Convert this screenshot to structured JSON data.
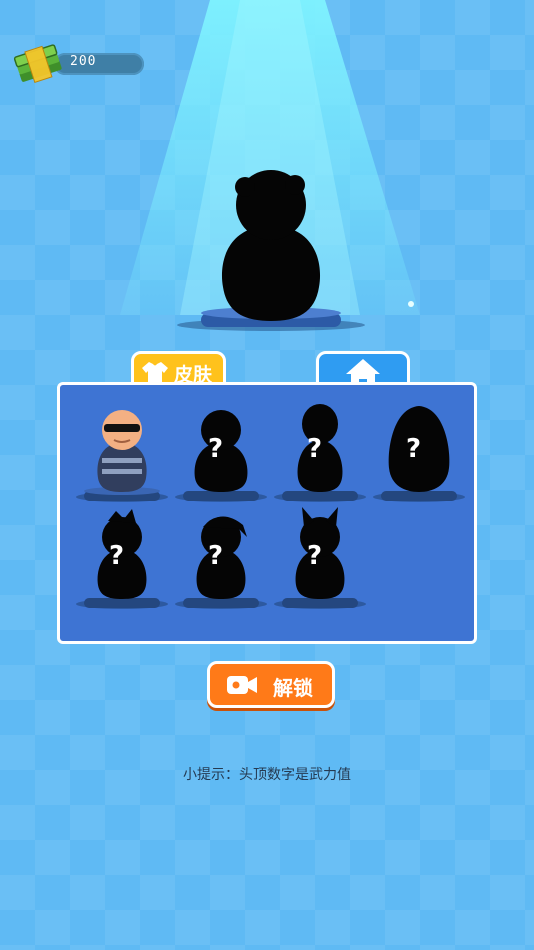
{
  "currency": {
    "amount": "200",
    "icon": "cash-stack-icon"
  },
  "tabs": {
    "skin_label": "皮肤",
    "skin_icon": "shirt-icon",
    "home_icon": "house-icon"
  },
  "featured": {
    "state": "locked-silhouette"
  },
  "characters": [
    {
      "state": "unlocked",
      "label": ""
    },
    {
      "state": "locked",
      "label": "?"
    },
    {
      "state": "locked",
      "label": "?"
    },
    {
      "state": "locked",
      "label": "?"
    },
    {
      "state": "locked",
      "label": "?"
    },
    {
      "state": "locked",
      "label": "?"
    },
    {
      "state": "locked",
      "label": "?"
    }
  ],
  "unlock_button": {
    "label": "解锁",
    "icon": "video-camera-icon"
  },
  "tip": "小提示：头顶数字是武力值",
  "colors": {
    "background": "#5fbaf4",
    "panel": "#3e74d3",
    "skin_tab": "#ffc21c",
    "home_tab": "#2f9cf2",
    "unlock": "#ff7a18"
  }
}
